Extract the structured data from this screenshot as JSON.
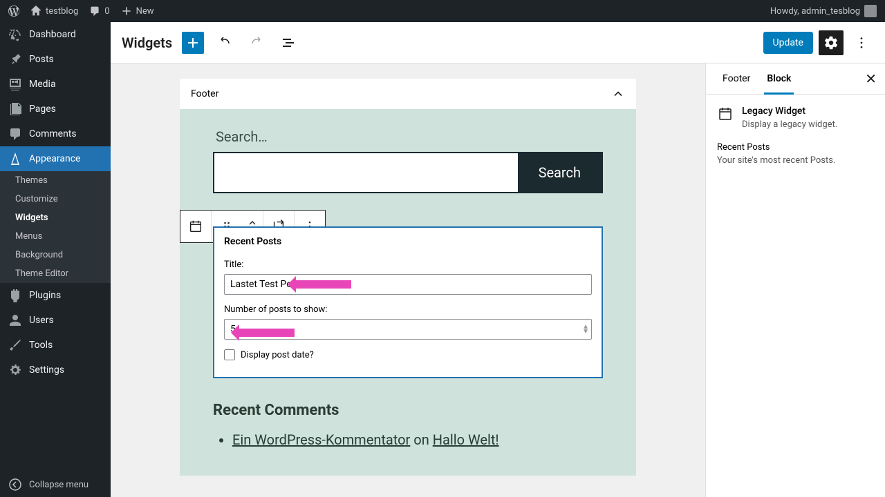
{
  "admin_bar": {
    "site_name": "testblog",
    "comment_count": "0",
    "new_label": "New",
    "howdy": "Howdy, admin_tesblog"
  },
  "sidebar": {
    "dashboard": "Dashboard",
    "posts": "Posts",
    "media": "Media",
    "pages": "Pages",
    "comments": "Comments",
    "appearance": "Appearance",
    "appearance_sub": {
      "themes": "Themes",
      "customize": "Customize",
      "widgets": "Widgets",
      "menus": "Menus",
      "background": "Background",
      "theme_editor": "Theme Editor"
    },
    "plugins": "Plugins",
    "users": "Users",
    "tools": "Tools",
    "settings": "Settings",
    "collapse": "Collapse menu"
  },
  "editor": {
    "title": "Widgets",
    "update": "Update"
  },
  "footer_area": {
    "title": "Footer",
    "search_label": "Search…",
    "search_button": "Search"
  },
  "widget": {
    "header": "Recent Posts",
    "title_label": "Title:",
    "title_value": "Lastet Test Posts",
    "count_label": "Number of posts to show:",
    "count_value": "5",
    "date_label": "Display post date?"
  },
  "comments": {
    "heading": "Recent Comments",
    "author": "Ein WordPress-Kommentator",
    "on": " on ",
    "post": "Hallo Welt!"
  },
  "panel": {
    "tab_footer": "Footer",
    "tab_block": "Block",
    "legacy_title": "Legacy Widget",
    "legacy_desc": "Display a legacy widget.",
    "recent_title": "Recent Posts",
    "recent_desc": "Your site's most recent Posts."
  }
}
